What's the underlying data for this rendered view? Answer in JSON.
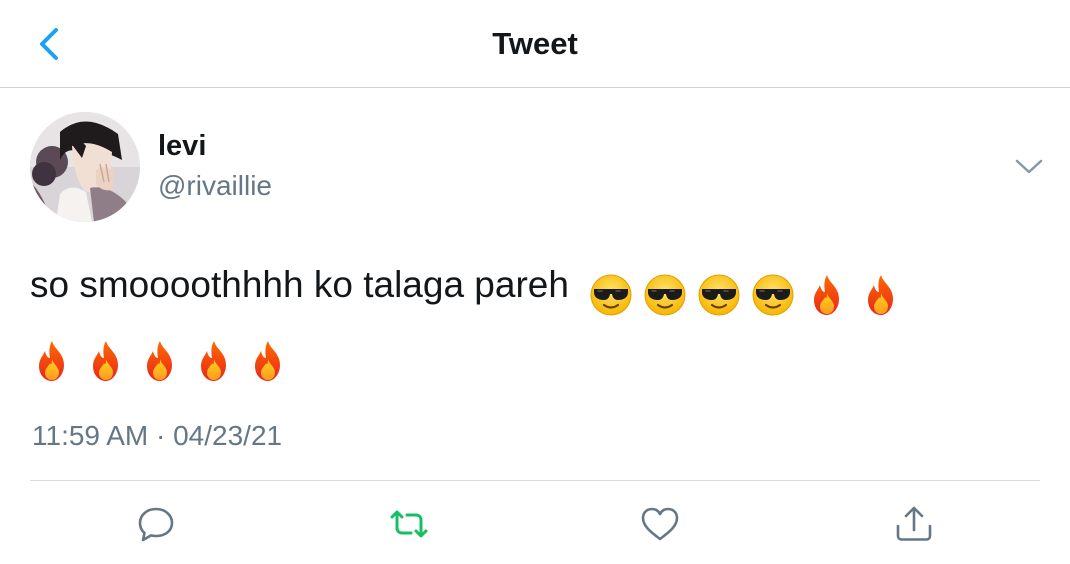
{
  "header": {
    "title": "Tweet",
    "back_icon": "chevron-left-icon"
  },
  "tweet": {
    "author": {
      "display_name": "levi",
      "handle": "@rivaillie"
    },
    "text": "so smoooothhhh ko talaga pareh",
    "emojis_line1": [
      "sunglasses-face",
      "sunglasses-face",
      "sunglasses-face",
      "sunglasses-face",
      "fire",
      "fire"
    ],
    "emojis_line2": [
      "fire",
      "fire",
      "fire",
      "fire",
      "fire"
    ],
    "timestamp": "11:59 AM · 04/23/21"
  },
  "actions": [
    {
      "name": "reply",
      "icon": "speech-bubble-icon"
    },
    {
      "name": "retweet",
      "icon": "retweet-icon"
    },
    {
      "name": "like",
      "icon": "heart-icon"
    },
    {
      "name": "share",
      "icon": "share-icon"
    }
  ],
  "colors": {
    "accent": "#1da1f2",
    "retweet": "#17bf63",
    "secondary_text": "#657786",
    "icon_gray": "#657786",
    "divider": "#cfd3d6"
  }
}
